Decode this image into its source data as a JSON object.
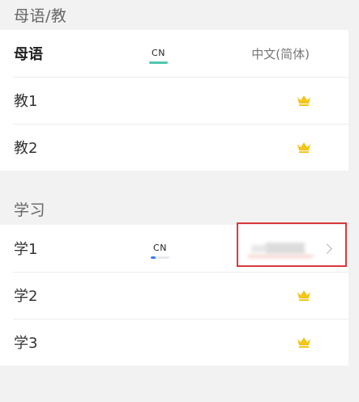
{
  "native_section": {
    "header": "母语/教",
    "rows": [
      {
        "label": "母语",
        "lang": "CN",
        "value": "中文(简体)"
      },
      {
        "label": "教1",
        "icon": "crown-icon"
      },
      {
        "label": "教2",
        "icon": "crown-icon"
      }
    ]
  },
  "learn_section": {
    "header": "学习",
    "rows": [
      {
        "label": "学1",
        "lang": "CN",
        "progress": 0.25
      },
      {
        "label": "学2",
        "icon": "crown-icon"
      },
      {
        "label": "学3",
        "icon": "crown-icon"
      }
    ]
  },
  "colors": {
    "accent_teal": "#4fc7ae",
    "progress_blue": "#3d7cf0",
    "crown_gold": "#f5c518",
    "highlight_red": "#d9383a"
  }
}
